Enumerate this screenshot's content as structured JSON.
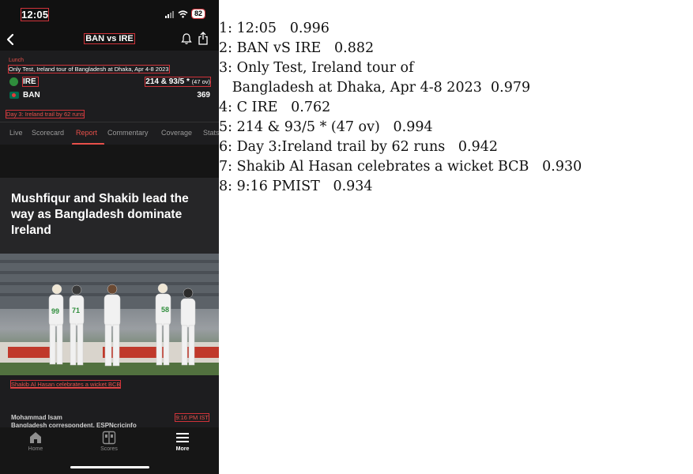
{
  "status_bar": {
    "time": "12:05",
    "battery": "82"
  },
  "nav": {
    "title": "BAN vs IRE"
  },
  "match": {
    "status": "Lunch",
    "series": "Only Test, Ireland tour of Bangladesh at Dhaka, Apr 4-8 2023",
    "teams": [
      {
        "name": "IRE",
        "score": "214 & 93/5 *",
        "overs": "(47 ov)"
      },
      {
        "name": "BAN",
        "score": "369",
        "overs": ""
      }
    ],
    "day_status": "Day 3: Ireland trail by 62 runs"
  },
  "tabs": [
    "Live",
    "Scorecard",
    "Report",
    "Commentary",
    "Coverage",
    "Stats"
  ],
  "active_tab": "Report",
  "article": {
    "headline": "Mushfiqur and Shakib lead the way as Bangladesh dominate Ireland",
    "photo_caption": "Shakib Al Hasan celebrates a wicket BCB",
    "author": "Mohammad Isam",
    "author_role": "Bangladesh correspondent, ESPNcricinfo",
    "time": "9:16 PM IST"
  },
  "bottom_nav": [
    {
      "label": "Home",
      "icon": "home-icon"
    },
    {
      "label": "Scores",
      "icon": "scores-icon"
    },
    {
      "label": "More",
      "icon": "menu-icon"
    }
  ],
  "ocr_results": [
    {
      "index": "1:",
      "text": "12:05",
      "score": "0.996"
    },
    {
      "index": "2:",
      "text": "BAN vS IRE",
      "score": "0.882"
    },
    {
      "index": "3:",
      "text": "Only Test, Ireland tour of",
      "text_cont": "Bangladesh at Dhaka, Apr 4-8 2023",
      "score": "0.979"
    },
    {
      "index": "4:",
      "text": "C IRE",
      "score": "0.762"
    },
    {
      "index": "5:",
      "text": "214 & 93/5 * (47 ov)",
      "score": "0.994"
    },
    {
      "index": "6:",
      "text": "Day 3:Ireland trail by 62 runs",
      "score": "0.942"
    },
    {
      "index": "7:",
      "text": "Shakib Al Hasan celebrates a wicket BCB",
      "score": "0.930"
    },
    {
      "index": "8:",
      "text": "9:16 PMIST",
      "score": "0.934"
    }
  ],
  "colors": {
    "accent": "#e8504a",
    "background": "#1d1d1f",
    "box": "#d0333a"
  }
}
